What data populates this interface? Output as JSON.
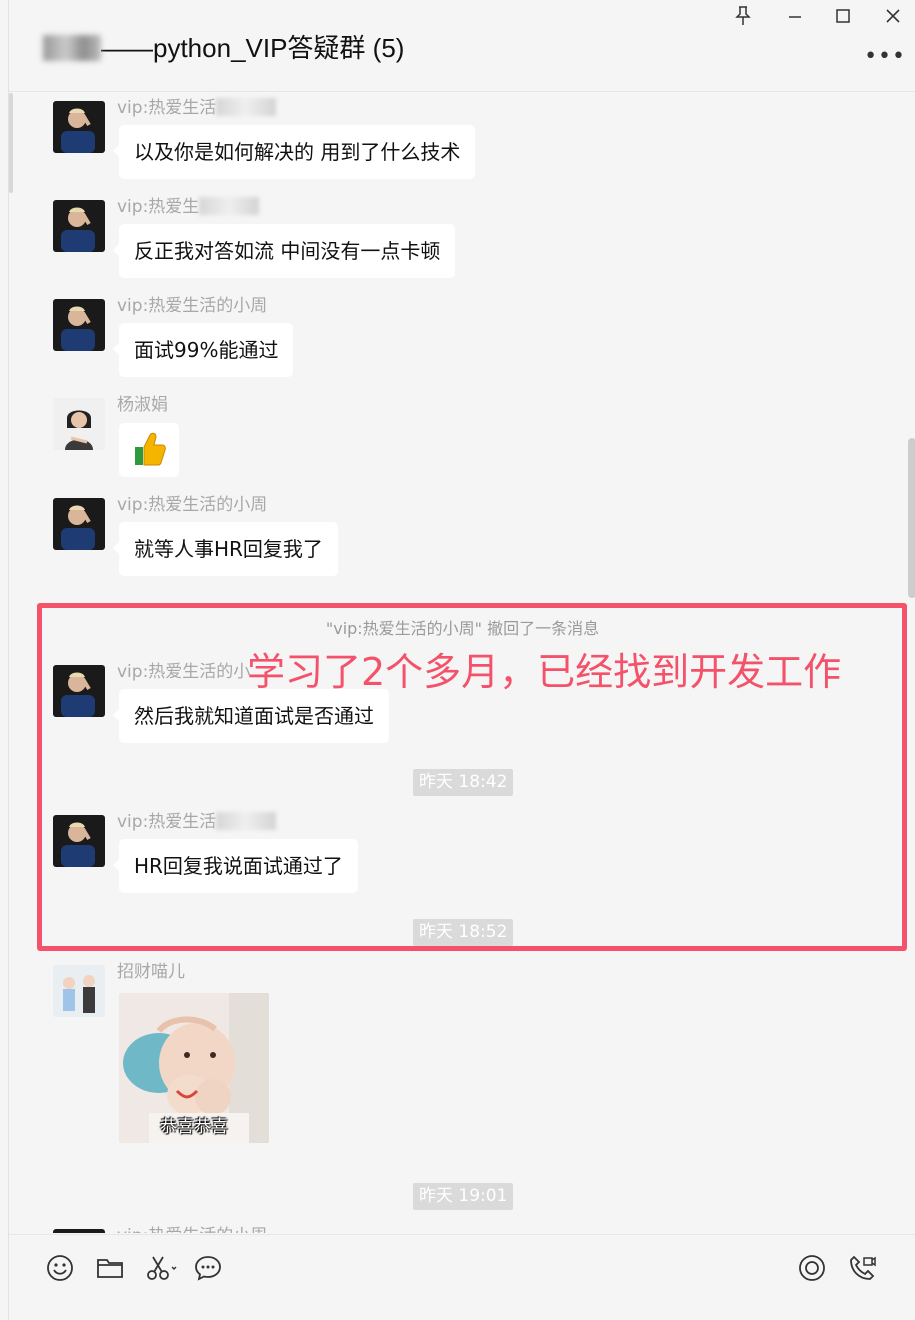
{
  "window": {
    "title_visible": "——python_VIP答疑群 (5)"
  },
  "messages": [
    {
      "sender": "vip:热爱生活",
      "text": "以及你是如何解决的 用到了什么技术"
    },
    {
      "sender": "vip:热爱生",
      "text": "反正我对答如流 中间没有一点卡顿"
    },
    {
      "sender": "vip:热爱生活的小周",
      "text": "面试99%能通过"
    },
    {
      "sender": "杨淑娟",
      "text": ""
    },
    {
      "sender": "vip:热爱生活的小周",
      "text": "就等人事HR回复我了"
    },
    {
      "sender": "vip:热爱生活的小",
      "text": "然后我就知道面试是否通过"
    },
    {
      "sender": "vip:热爱生活",
      "text": "HR回复我说面试通过了"
    },
    {
      "sender": "招财喵儿",
      "text": ""
    },
    {
      "sender": "vip:热爱生活的小周",
      "text": ""
    }
  ],
  "system": {
    "recall_notice": "\"vip:热爱生活的小周\" 撤回了一条消息"
  },
  "timestamps": [
    "昨天 18:42",
    "昨天 18:52",
    "昨天 19:01"
  ],
  "annotation": {
    "text": "学习了2个多月，已经找到开发工作",
    "color": "#f4526a"
  },
  "sticker": {
    "caption": "恭喜恭喜"
  },
  "icons": {
    "title_bar": [
      "pin-icon",
      "minimize-icon",
      "maximize-icon",
      "close-icon",
      "more-icon"
    ],
    "toolbar_left": [
      "emoji-icon",
      "folder-icon",
      "scissors-icon",
      "chat-bubble-icon"
    ],
    "toolbar_right": [
      "live-icon",
      "call-icon"
    ]
  }
}
